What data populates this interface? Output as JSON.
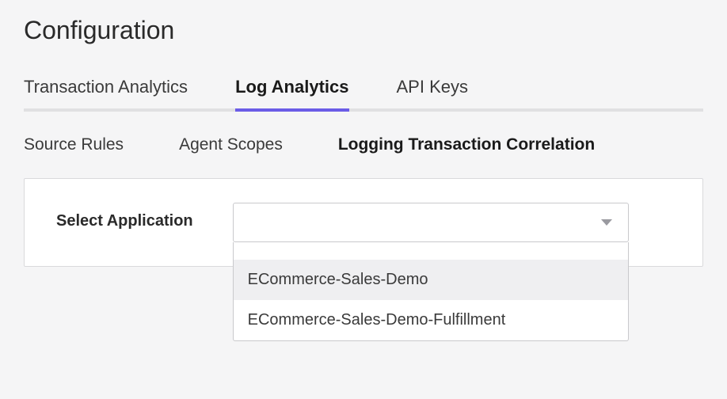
{
  "page": {
    "title": "Configuration"
  },
  "primaryTabs": {
    "items": [
      {
        "label": "Transaction Analytics",
        "active": false
      },
      {
        "label": "Log Analytics",
        "active": true
      },
      {
        "label": "API Keys",
        "active": false
      }
    ]
  },
  "secondaryTabs": {
    "items": [
      {
        "label": "Source Rules",
        "active": false
      },
      {
        "label": "Agent Scopes",
        "active": false
      },
      {
        "label": "Logging Transaction Correlation",
        "active": true
      }
    ]
  },
  "form": {
    "selectApplication": {
      "label": "Select Application",
      "value": "",
      "options": [
        {
          "label": "ECommerce-Sales-Demo",
          "highlighted": true
        },
        {
          "label": "ECommerce-Sales-Demo-Fulfillment",
          "highlighted": false
        }
      ]
    }
  }
}
